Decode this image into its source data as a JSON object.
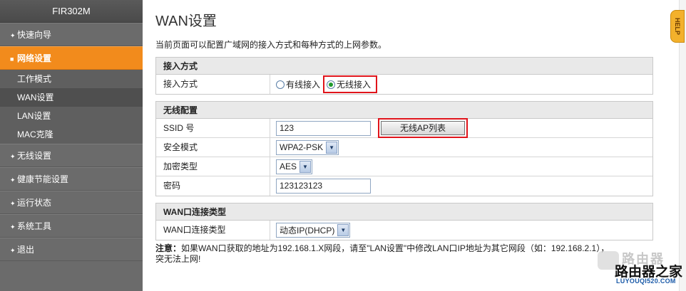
{
  "sidebar": {
    "brand": "FIR302M",
    "items": [
      {
        "label": "快速向导",
        "bullet": "✦"
      },
      {
        "label": "网络设置",
        "bullet": "■"
      },
      {
        "label": "无线设置",
        "bullet": "✦"
      },
      {
        "label": "健康节能设置",
        "bullet": "✦"
      },
      {
        "label": "运行状态",
        "bullet": "✦"
      },
      {
        "label": "系统工具",
        "bullet": "✦"
      },
      {
        "label": "退出",
        "bullet": "✦"
      }
    ],
    "subitems": [
      "工作模式",
      "WAN设置",
      "LAN设置",
      "MAC克隆"
    ]
  },
  "header": {
    "title": "WAN设置",
    "description": "当前页面可以配置广域网的接入方式和每种方式的上网参数。"
  },
  "access_panel": {
    "title": "接入方式",
    "label": "接入方式",
    "option_wired": "有线接入",
    "option_wireless": "无线接入"
  },
  "wireless_panel": {
    "title": "无线配置",
    "ssid_label": "SSID 号",
    "ssid_value": "123",
    "ap_list_button": "无线AP列表",
    "security_label": "安全模式",
    "security_value": "WPA2-PSK",
    "encryption_label": "加密类型",
    "encryption_value": "AES",
    "password_label": "密码",
    "password_value": "123123123"
  },
  "wan_panel": {
    "title": "WAN口连接类型",
    "label": "WAN口连接类型",
    "value": "动态IP(DHCP)"
  },
  "note": {
    "prefix": "注意：",
    "text": "如果WAN口获取的地址为192.168.1.X网段，请至\"LAN设置\"中修改LAN口IP地址为其它网段（如：192.168.2.1），",
    "text2": "突无法上网!"
  },
  "help": {
    "label": "HELP"
  },
  "watermark": {
    "line1": "路由器",
    "line2": "路由器之家",
    "url": "LUYOUQI520.COM"
  },
  "colors": {
    "accent": "#f28b1c",
    "highlight": "#e0141b",
    "sidebar": "#6b6b6b"
  }
}
